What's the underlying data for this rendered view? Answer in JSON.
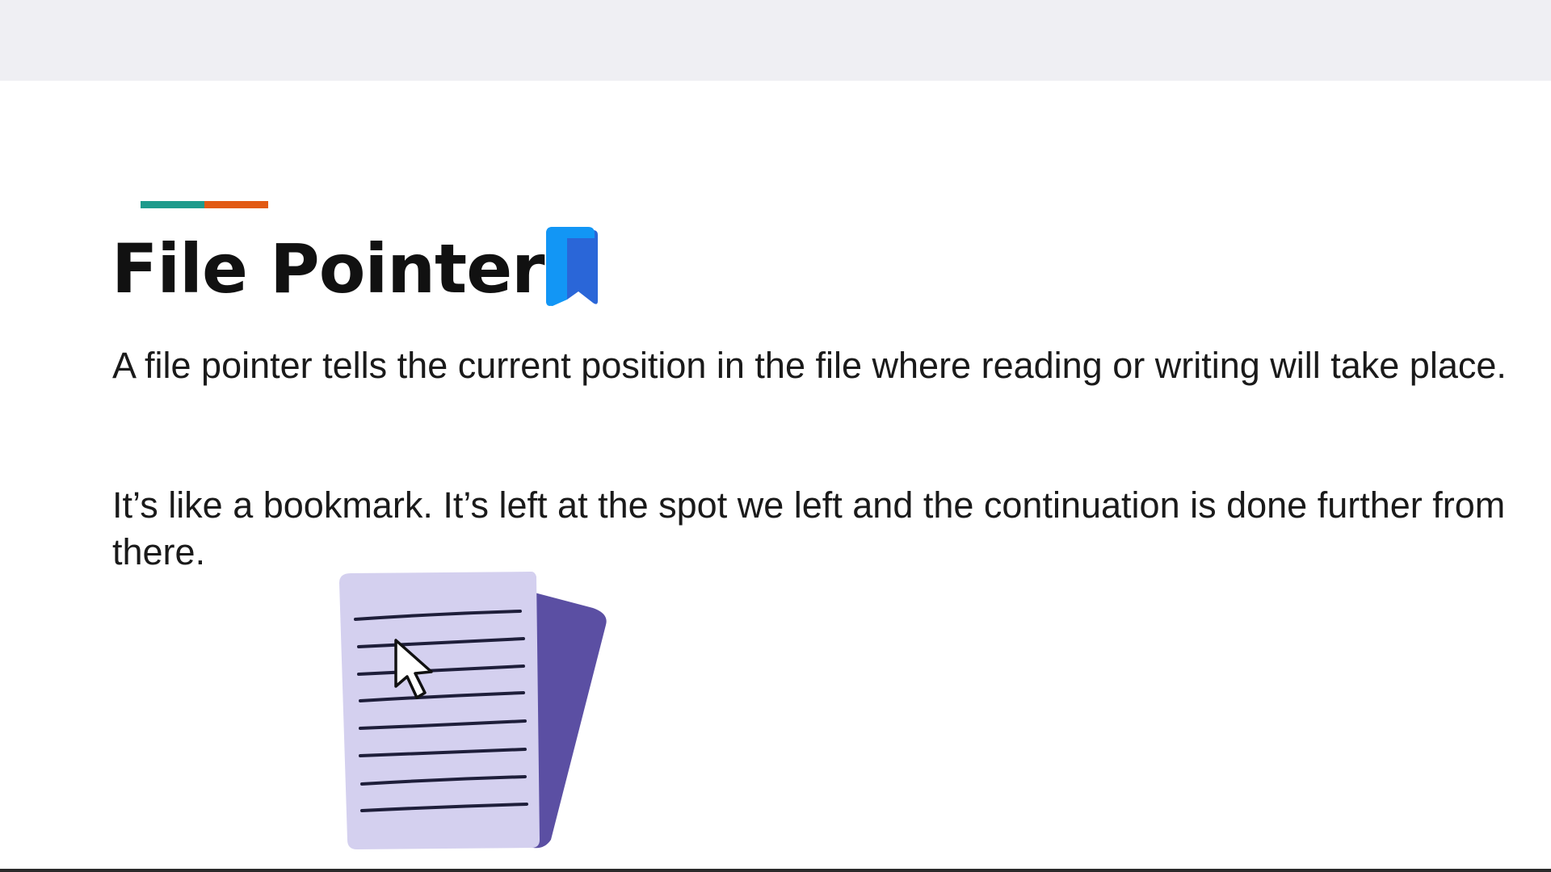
{
  "slide": {
    "title": "File Pointers",
    "title_icon": "bookmark-icon",
    "accent_colors": [
      "#1f9b8c",
      "#e25a14"
    ],
    "bookmark_colors": [
      "#1296f5",
      "#2a66d8"
    ],
    "paragraphs": [
      "A file pointer tells the current position in the file where reading or writing will take place.",
      "It’s like a bookmark. It’s left at the spot we left and the continuation is done further from there."
    ],
    "illustration": {
      "icon": "document-with-cursor-icon",
      "paper_color": "#d4d0ef",
      "back_sheet_color": "#5b4fa3",
      "line_color": "#1e1e3a"
    }
  }
}
